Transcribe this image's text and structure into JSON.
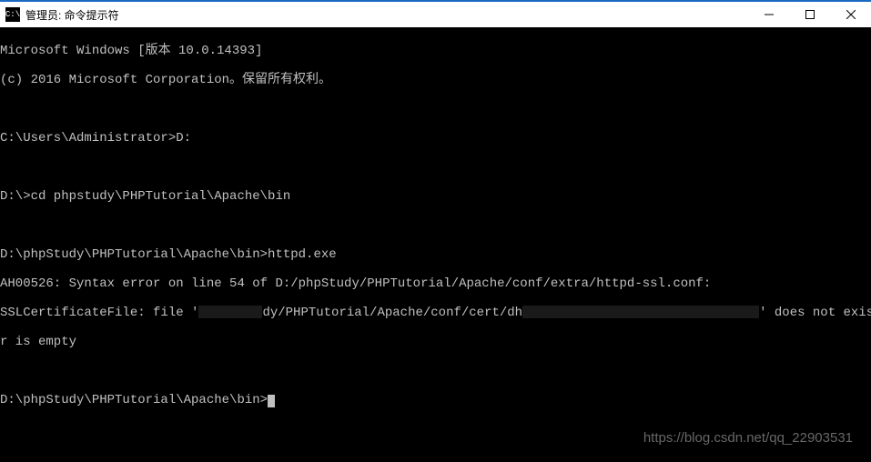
{
  "titlebar": {
    "icon_label": "C:\\",
    "title": "管理员: 命令提示符"
  },
  "terminal": {
    "line1": "Microsoft Windows [版本 10.0.14393]",
    "line2": "(c) 2016 Microsoft Corporation。保留所有权利。",
    "line3": "",
    "line4": "C:\\Users\\Administrator>D:",
    "line5": "",
    "line6": "D:\\>cd phpstudy\\PHPTutorial\\Apache\\bin",
    "line7": "",
    "line8": "D:\\phpStudy\\PHPTutorial\\Apache\\bin>httpd.exe",
    "line9": "AH00526: Syntax error on line 54 of D:/phpStudy/PHPTutorial/Apache/conf/extra/httpd-ssl.conf:",
    "line10a": "SSLCertificateFile: file '",
    "line10b": "dy/PHPTutorial/Apache/conf/cert/dh",
    "line10c": "' does not exist o",
    "line11": "r is empty",
    "line12": "",
    "prompt": "D:\\phpStudy\\PHPTutorial\\Apache\\bin>"
  },
  "watermark": "https://blog.csdn.net/qq_22903531"
}
